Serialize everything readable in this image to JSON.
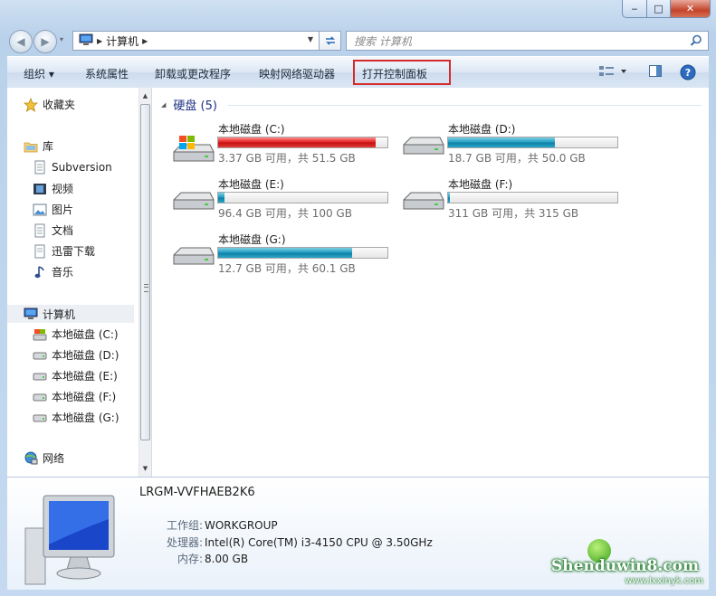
{
  "window": {
    "caption_min": "‒",
    "caption_max": "□",
    "caption_close": "✕"
  },
  "nav": {
    "back": "◀",
    "forward": "▶",
    "history": "▾",
    "address": [
      "计算机"
    ],
    "search_placeholder": "搜索 计算机"
  },
  "toolbar": {
    "organize": "组织 ▾",
    "system_properties": "系统属性",
    "uninstall": "卸载或更改程序",
    "map_drive": "映射网络驱动器",
    "open_control_panel": "打开控制面板",
    "highlight_color": "#d52a2a"
  },
  "sidebar": {
    "favorites": "收藏夹",
    "libraries": "库",
    "library_items": [
      "Subversion",
      "视频",
      "图片",
      "文档",
      "迅雷下载",
      "音乐"
    ],
    "computer": "计算机",
    "drives": [
      "本地磁盘 (C:)",
      "本地磁盘 (D:)",
      "本地磁盘 (E:)",
      "本地磁盘 (F:)",
      "本地磁盘 (G:)"
    ],
    "network": "网络"
  },
  "main": {
    "group_title": "硬盘 (5)",
    "drives": [
      {
        "name": "本地磁盘 (C:)",
        "free": "3.37 GB 可用，共 51.5 GB",
        "used_fraction": 0.93,
        "color": "#d41c1c",
        "system": true
      },
      {
        "name": "本地磁盘 (D:)",
        "free": "18.7 GB 可用，共 50.0 GB",
        "used_fraction": 0.63,
        "color": "#1a8fb6",
        "system": false
      },
      {
        "name": "本地磁盘 (E:)",
        "free": "96.4 GB 可用，共 100 GB",
        "used_fraction": 0.04,
        "color": "#1a8fb6",
        "system": false
      },
      {
        "name": "本地磁盘 (F:)",
        "free": "311 GB 可用，共 315 GB",
        "used_fraction": 0.013,
        "color": "#1a8fb6",
        "system": false
      },
      {
        "name": "本地磁盘 (G:)",
        "free": "12.7 GB 可用，共 60.1 GB",
        "used_fraction": 0.79,
        "color": "#1a8fb6",
        "system": false
      }
    ]
  },
  "details": {
    "computer_name": "LRGM-VVFHAEB2K6",
    "workgroup_label": "工作组:",
    "workgroup": "WORKGROUP",
    "cpu_label": "处理器:",
    "cpu": "Intel(R) Core(TM) i3-4150 CPU @ 3.50GHz",
    "memory_label": "内存:",
    "memory": "8.00 GB"
  },
  "watermark": {
    "text": "Shenduwin8.com",
    "url": "www.lxxinyk.com"
  }
}
